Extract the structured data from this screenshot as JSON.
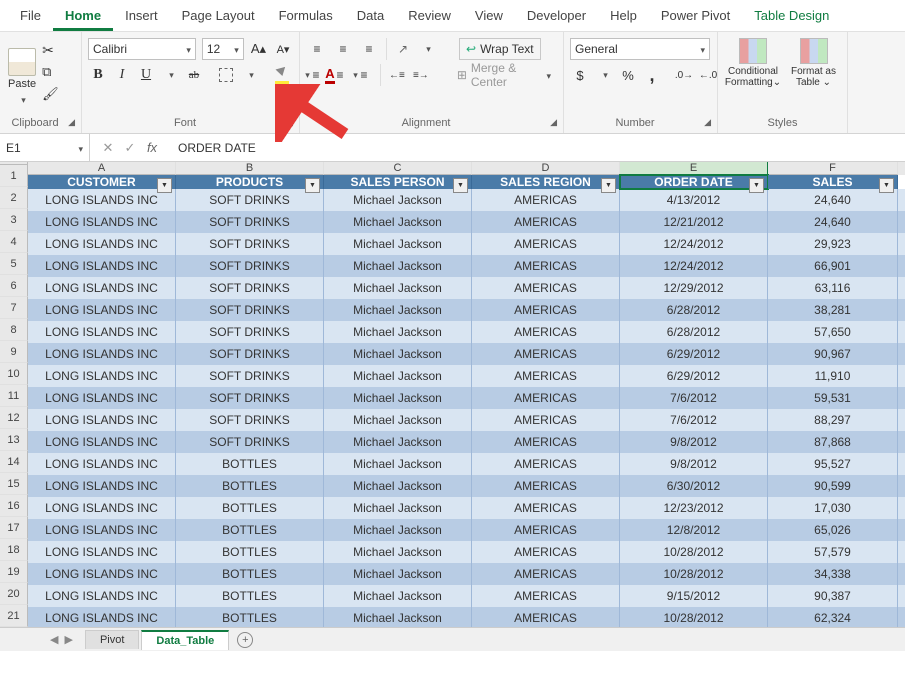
{
  "ribbon_tabs": {
    "file": "File",
    "home": "Home",
    "insert": "Insert",
    "pagelayout": "Page Layout",
    "formulas": "Formulas",
    "data": "Data",
    "review": "Review",
    "view": "View",
    "developer": "Developer",
    "help": "Help",
    "powerpivot": "Power Pivot",
    "tabledesign": "Table Design"
  },
  "clipboard": {
    "paste": "Paste",
    "group_label": "Clipboard"
  },
  "font": {
    "name": "Calibri",
    "size": "12",
    "bold": "B",
    "italic": "I",
    "underline": "U",
    "strike": "ab",
    "fontcolor_letter": "A",
    "group_label": "Font"
  },
  "alignment": {
    "wraptext": "Wrap Text",
    "merge": "Merge & Center",
    "group_label": "Alignment"
  },
  "number": {
    "format": "General",
    "group_label": "Number"
  },
  "styles": {
    "cond": "Conditional Formatting⌄",
    "table": "Format as Table ⌄",
    "group_label": "Styles"
  },
  "namebox": "E1",
  "formula": "ORDER DATE",
  "columns": [
    "A",
    "B",
    "C",
    "D",
    "E",
    "F"
  ],
  "headers": [
    "CUSTOMER",
    "PRODUCTS",
    "SALES PERSON",
    "SALES REGION",
    "ORDER DATE",
    "SALES"
  ],
  "rows": [
    [
      "LONG ISLANDS INC",
      "SOFT DRINKS",
      "Michael Jackson",
      "AMERICAS",
      "4/13/2012",
      "24,640"
    ],
    [
      "LONG ISLANDS INC",
      "SOFT DRINKS",
      "Michael Jackson",
      "AMERICAS",
      "12/21/2012",
      "24,640"
    ],
    [
      "LONG ISLANDS INC",
      "SOFT DRINKS",
      "Michael Jackson",
      "AMERICAS",
      "12/24/2012",
      "29,923"
    ],
    [
      "LONG ISLANDS INC",
      "SOFT DRINKS",
      "Michael Jackson",
      "AMERICAS",
      "12/24/2012",
      "66,901"
    ],
    [
      "LONG ISLANDS INC",
      "SOFT DRINKS",
      "Michael Jackson",
      "AMERICAS",
      "12/29/2012",
      "63,116"
    ],
    [
      "LONG ISLANDS INC",
      "SOFT DRINKS",
      "Michael Jackson",
      "AMERICAS",
      "6/28/2012",
      "38,281"
    ],
    [
      "LONG ISLANDS INC",
      "SOFT DRINKS",
      "Michael Jackson",
      "AMERICAS",
      "6/28/2012",
      "57,650"
    ],
    [
      "LONG ISLANDS INC",
      "SOFT DRINKS",
      "Michael Jackson",
      "AMERICAS",
      "6/29/2012",
      "90,967"
    ],
    [
      "LONG ISLANDS INC",
      "SOFT DRINKS",
      "Michael Jackson",
      "AMERICAS",
      "6/29/2012",
      "11,910"
    ],
    [
      "LONG ISLANDS INC",
      "SOFT DRINKS",
      "Michael Jackson",
      "AMERICAS",
      "7/6/2012",
      "59,531"
    ],
    [
      "LONG ISLANDS INC",
      "SOFT DRINKS",
      "Michael Jackson",
      "AMERICAS",
      "7/6/2012",
      "88,297"
    ],
    [
      "LONG ISLANDS INC",
      "SOFT DRINKS",
      "Michael Jackson",
      "AMERICAS",
      "9/8/2012",
      "87,868"
    ],
    [
      "LONG ISLANDS INC",
      "BOTTLES",
      "Michael Jackson",
      "AMERICAS",
      "9/8/2012",
      "95,527"
    ],
    [
      "LONG ISLANDS INC",
      "BOTTLES",
      "Michael Jackson",
      "AMERICAS",
      "6/30/2012",
      "90,599"
    ],
    [
      "LONG ISLANDS INC",
      "BOTTLES",
      "Michael Jackson",
      "AMERICAS",
      "12/23/2012",
      "17,030"
    ],
    [
      "LONG ISLANDS INC",
      "BOTTLES",
      "Michael Jackson",
      "AMERICAS",
      "12/8/2012",
      "65,026"
    ],
    [
      "LONG ISLANDS INC",
      "BOTTLES",
      "Michael Jackson",
      "AMERICAS",
      "10/28/2012",
      "57,579"
    ],
    [
      "LONG ISLANDS INC",
      "BOTTLES",
      "Michael Jackson",
      "AMERICAS",
      "10/28/2012",
      "34,338"
    ],
    [
      "LONG ISLANDS INC",
      "BOTTLES",
      "Michael Jackson",
      "AMERICAS",
      "9/15/2012",
      "90,387"
    ],
    [
      "LONG ISLANDS INC",
      "BOTTLES",
      "Michael Jackson",
      "AMERICAS",
      "10/28/2012",
      "62,324"
    ]
  ],
  "sheets": {
    "pivot": "Pivot",
    "data_table": "Data_Table"
  }
}
